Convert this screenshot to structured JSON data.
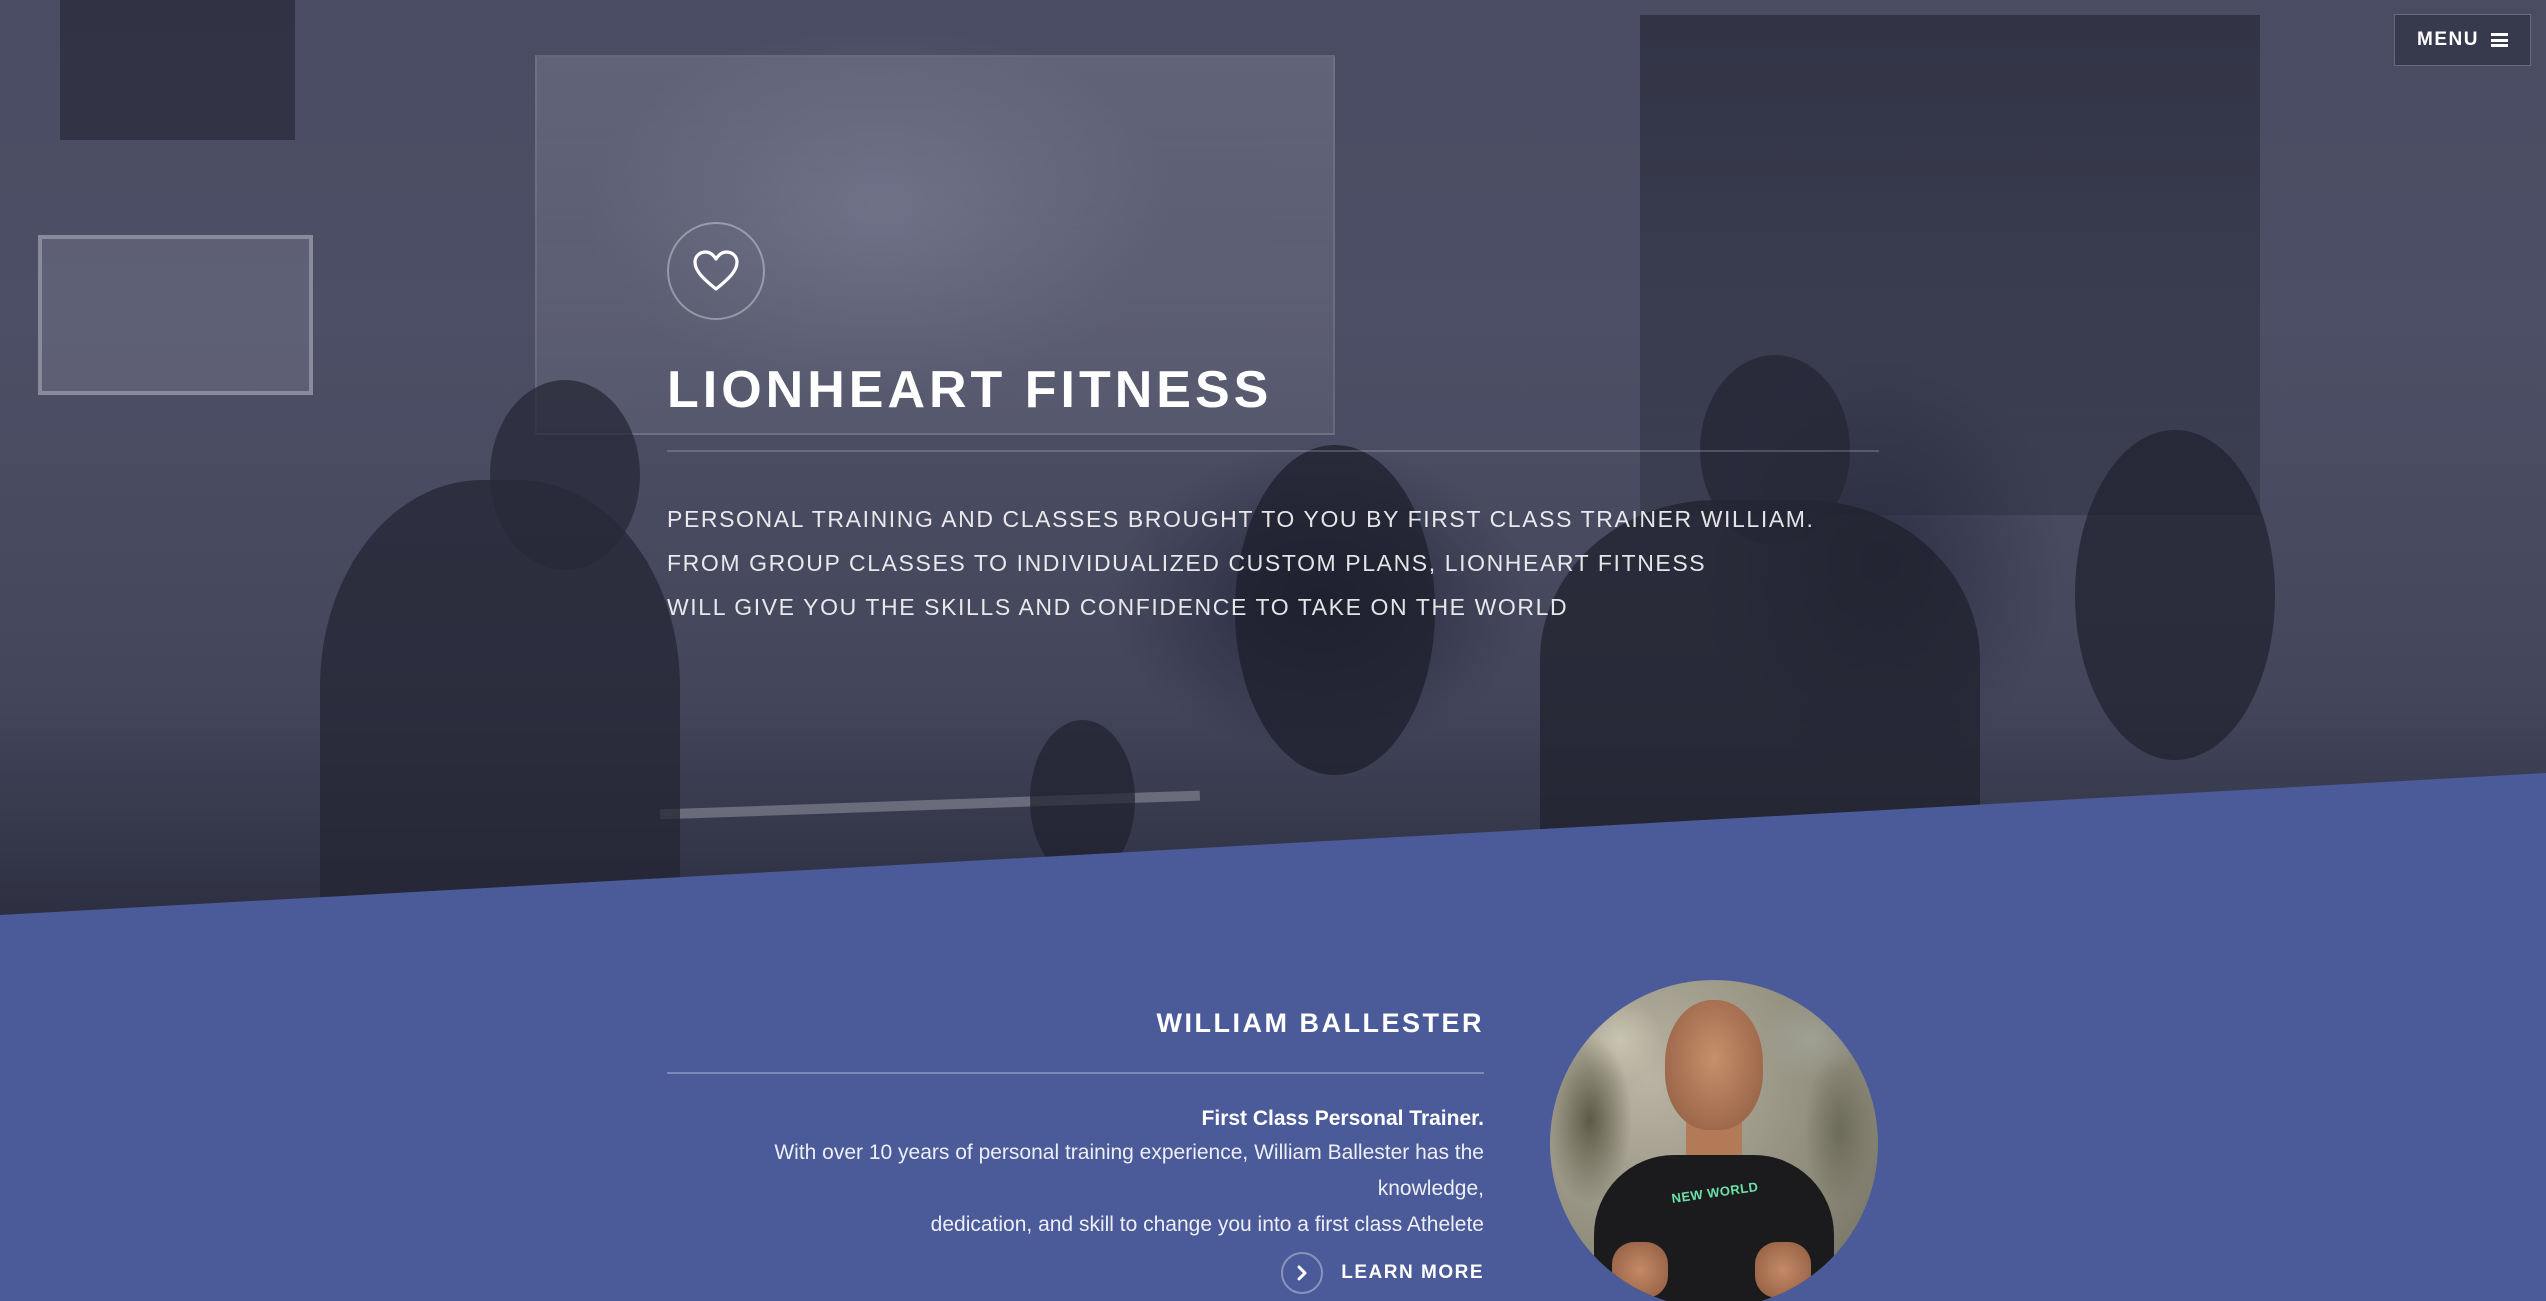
{
  "nav": {
    "menu_label": "MENU",
    "menu_icon": "hamburger-icon"
  },
  "hero": {
    "icon": "heart-icon",
    "title": "LIONHEART FITNESS",
    "tagline_lines": [
      "PERSONAL TRAINING AND CLASSES BROUGHT TO YOU BY FIRST CLASS TRAINER WILLIAM.",
      "FROM GROUP CLASSES TO INDIVIDUALIZED CUSTOM PLANS, LIONHEART FITNESS",
      "WILL GIVE YOU THE SKILLS AND CONFIDENCE TO TAKE ON THE WORLD"
    ]
  },
  "about": {
    "name": "WILLIAM BALLESTER",
    "headline": "First Class Personal Trainer.",
    "body_lines": [
      "With over 10 years of personal training experience, William Ballester has the knowledge,",
      "dedication, and skill to change you into a first class Athelete"
    ],
    "cta_label": "LEARN MORE",
    "cta_icon": "chevron-right-icon",
    "portrait_shirt_text": "NEW WORLD"
  },
  "colors": {
    "section_blue": "#4b5b99",
    "hero_overlay": "#4a4c63",
    "text": "#ffffff"
  }
}
